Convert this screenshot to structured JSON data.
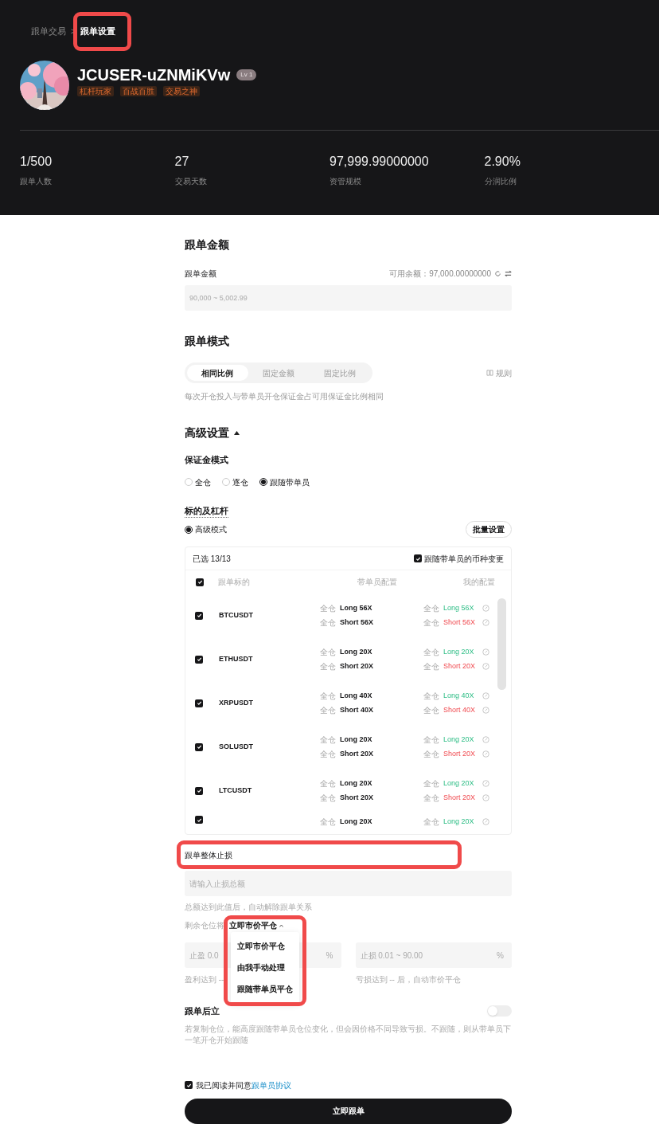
{
  "breadcrumb": [
    {
      "label": "跟单交易",
      "selected": false
    },
    {
      "label": "跟单设置",
      "selected": true
    }
  ],
  "breadcrumb_separator": ">",
  "profile": {
    "name": "JCUSER-uZNMiKVw",
    "level": "Lv 1",
    "tags": [
      "杠杆玩家",
      "百战百胜",
      "交易之神"
    ]
  },
  "stats": [
    {
      "value": "1/500",
      "label": "跟单人数"
    },
    {
      "value": "27",
      "label": "交易天数"
    },
    {
      "value": "97,999.99000000",
      "label": "资管规模"
    },
    {
      "value": "2.90%",
      "label": "分润比例"
    }
  ],
  "amount": {
    "title": "跟单金额",
    "label": "跟单金额",
    "balance": "可用余额：97,000.00000000",
    "placeholder": "90,000 ~ 5,002.99"
  },
  "mode": {
    "title": "跟单模式",
    "tabs": [
      {
        "label": "相同比例",
        "selected": true
      },
      {
        "label": "固定金额",
        "selected": false
      },
      {
        "label": "固定比例",
        "selected": false
      }
    ],
    "rules": "规则",
    "description": "每次开仓投入与带单员开仓保证金占可用保证金比例相同"
  },
  "advanced": {
    "title": "高级设置",
    "expanded": true,
    "margin": {
      "title": "保证金模式",
      "options": [
        {
          "label": "全仓",
          "selected": false
        },
        {
          "label": "逐仓",
          "selected": false
        },
        {
          "label": "跟随带单员",
          "selected": true
        }
      ]
    },
    "leverage": {
      "title": "标的及杠杆",
      "mode": {
        "label": "高级模式",
        "selected": true
      },
      "batch_button": "批量设置"
    },
    "table": {
      "selected_count": "已选 13/13",
      "follow": {
        "label": "跟随带单员的币种变更",
        "checked": true
      },
      "columns": [
        "跟单标的",
        "带单员配置",
        "我的配置"
      ],
      "all_checked": true,
      "rows": [
        {
          "checked": true,
          "symbol": "BTCUSDT",
          "lead": [
            {
              "mode": "全仓",
              "side": "Long 56X"
            },
            {
              "mode": "全仓",
              "side": "Short 56X"
            }
          ],
          "mine": [
            {
              "mode": "全仓",
              "side": "Long 56X",
              "kind": "long"
            },
            {
              "mode": "全仓",
              "side": "Short 56X",
              "kind": "short"
            }
          ]
        },
        {
          "checked": true,
          "symbol": "ETHUSDT",
          "lead": [
            {
              "mode": "全仓",
              "side": "Long 20X"
            },
            {
              "mode": "全仓",
              "side": "Short 20X"
            }
          ],
          "mine": [
            {
              "mode": "全仓",
              "side": "Long 20X",
              "kind": "long"
            },
            {
              "mode": "全仓",
              "side": "Short 20X",
              "kind": "short"
            }
          ]
        },
        {
          "checked": true,
          "symbol": "XRPUSDT",
          "lead": [
            {
              "mode": "全仓",
              "side": "Long 40X"
            },
            {
              "mode": "全仓",
              "side": "Short 40X"
            }
          ],
          "mine": [
            {
              "mode": "全仓",
              "side": "Long 40X",
              "kind": "long"
            },
            {
              "mode": "全仓",
              "side": "Short 40X",
              "kind": "short"
            }
          ]
        },
        {
          "checked": true,
          "symbol": "SOLUSDT",
          "lead": [
            {
              "mode": "全仓",
              "side": "Long 20X"
            },
            {
              "mode": "全仓",
              "side": "Short 20X"
            }
          ],
          "mine": [
            {
              "mode": "全仓",
              "side": "Long 20X",
              "kind": "long"
            },
            {
              "mode": "全仓",
              "side": "Short 20X",
              "kind": "short"
            }
          ]
        },
        {
          "checked": true,
          "symbol": "LTCUSDT",
          "lead": [
            {
              "mode": "全仓",
              "side": "Long 20X"
            },
            {
              "mode": "全仓",
              "side": "Short 20X"
            }
          ],
          "mine": [
            {
              "mode": "全仓",
              "side": "Long 20X",
              "kind": "long"
            },
            {
              "mode": "全仓",
              "side": "Short 20X",
              "kind": "short"
            }
          ]
        },
        {
          "checked": true,
          "lead": [
            {
              "mode": "全仓",
              "side": "Long 20X"
            }
          ],
          "mine": [
            {
              "mode": "全仓",
              "side": "Long 20X",
              "kind": "long"
            }
          ]
        }
      ]
    }
  },
  "stop_loss": {
    "title": "跟单整体止损",
    "placeholder": "请输入止损总额",
    "hint": "总额达到此值后，自动解除跟单关系",
    "remaining_label": "剩余仓位将",
    "dropdown": {
      "value": "立即市价平仓",
      "expanded": true,
      "options": [
        "立即市价平仓",
        "由我手动处理",
        "跟随带单员平仓"
      ]
    },
    "take_profit": {
      "placeholder": "止盈 0.0",
      "unit": "%",
      "hint": "盈利达到 --"
    },
    "stop": {
      "placeholder": "止损 0.01 ~ 90.00",
      "unit": "%",
      "hint": "亏损达到 -- 后，自动市价平仓"
    }
  },
  "copy_positions": {
    "title": "跟单后立",
    "on": false,
    "description": "若复制仓位，能高度跟随带单员仓位变化，但会因价格不同导致亏损。不跟随，则从带单员下一笔开仓开始跟随"
  },
  "agreement": {
    "checked": true,
    "text": "我已阅读并同意",
    "link": "跟单员协议"
  },
  "submit": "立即跟单"
}
